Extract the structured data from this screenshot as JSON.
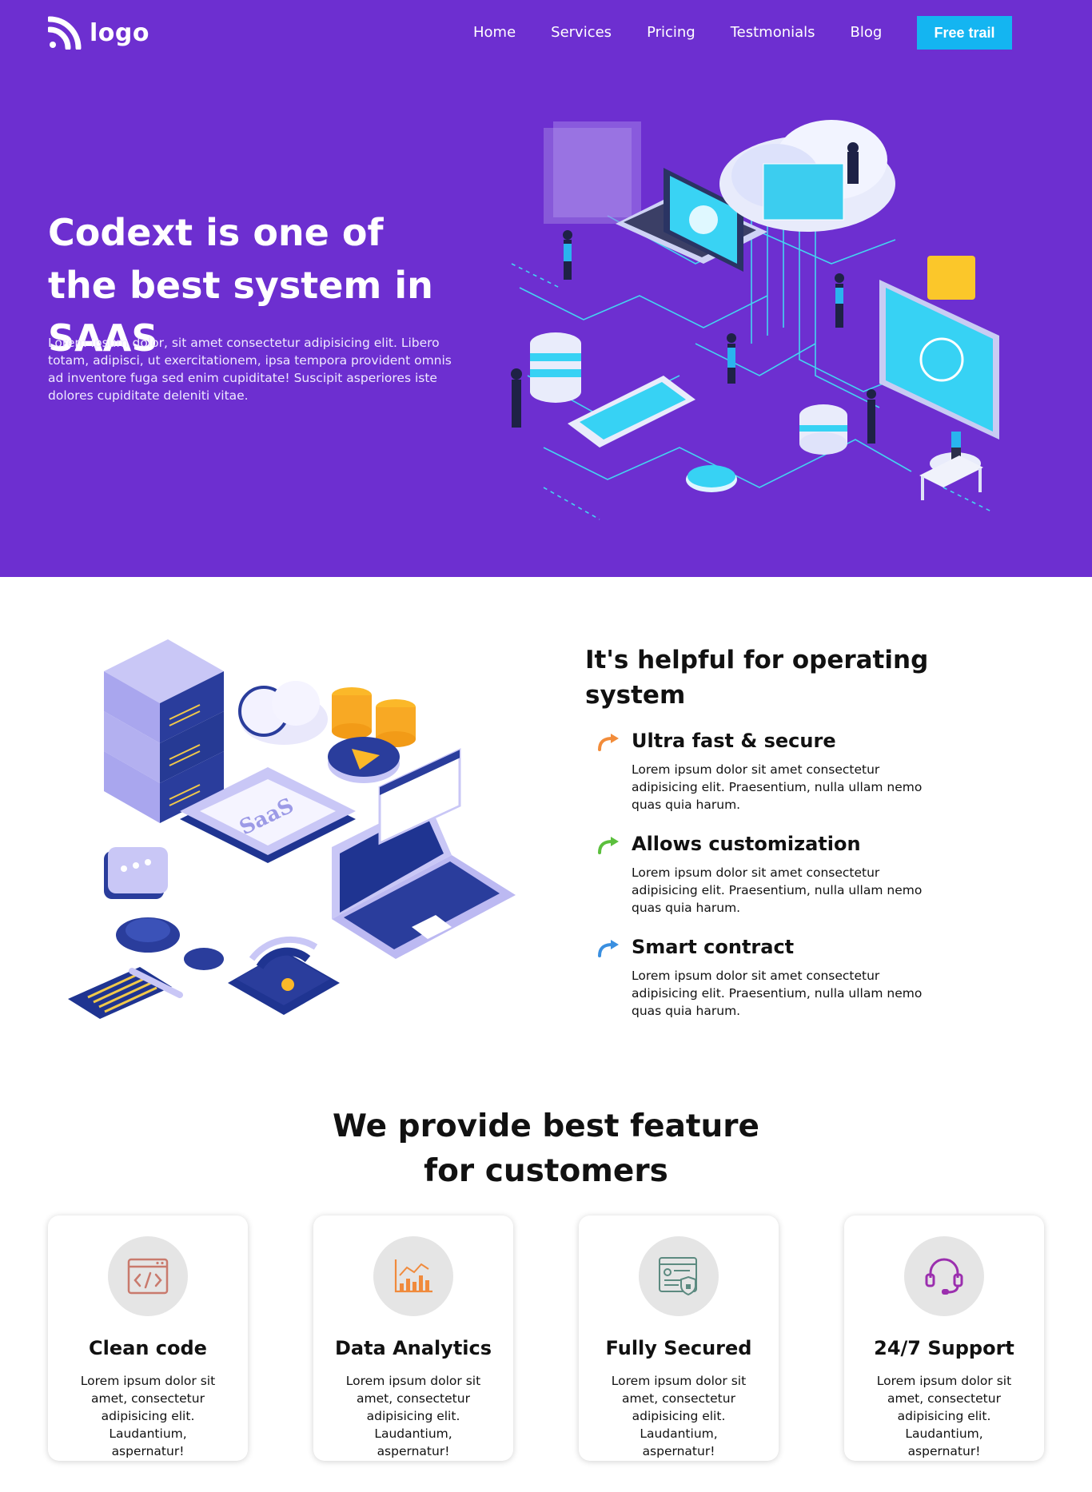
{
  "nav": {
    "logo_text": "logo",
    "items": [
      {
        "label": "Home"
      },
      {
        "label": "Services"
      },
      {
        "label": "Pricing"
      },
      {
        "label": "Testmonials"
      },
      {
        "label": "Blog"
      }
    ],
    "cta_label": "Free trail"
  },
  "hero": {
    "title": "Codext is one of the best system in SAAS",
    "description": "Lorem ipsum dolor, sit amet consectetur adipisicing elit. Libero totam, adipisci, ut exercitationem, ipsa tempora provident omnis ad inventore fuga sed enim cupiditate! Suscipit asperiores iste dolores cupiditate deleniti vitae.",
    "background_color": "#6d2fd0",
    "illustration_icon": "isometric-cloud-network-illustration"
  },
  "helpful": {
    "title": "It's helpful for operating system",
    "illustration_label": "SaaS",
    "features": [
      {
        "title": "Ultra fast & secure",
        "text": "Lorem ipsum dolor sit amet consectetur adipisicing elit. Praesentium, nulla ullam nemo quas quia harum.",
        "arrow_color": "#f28c3a"
      },
      {
        "title": "Allows customization",
        "text": "Lorem ipsum dolor sit amet consectetur adipisicing elit. Praesentium, nulla ullam nemo quas quia harum.",
        "arrow_color": "#5bbf3d"
      },
      {
        "title": "Smart contract",
        "text": "Lorem ipsum dolor sit amet consectetur adipisicing elit. Praesentium, nulla ullam nemo quas quia harum.",
        "arrow_color": "#3a8fe0"
      }
    ]
  },
  "features": {
    "title": "We provide best feature for customers",
    "cards": [
      {
        "title": "Clean code",
        "text": "Lorem ipsum dolor sit amet, consectetur adipisicing elit. Laudantium, aspernatur!",
        "icon": "code-window-icon",
        "icon_color": "#c97a6d"
      },
      {
        "title": "Data Analytics",
        "text": "Lorem ipsum dolor sit amet, consectetur adipisicing elit. Laudantium, aspernatur!",
        "icon": "bar-chart-icon",
        "icon_color": "#f08a3c"
      },
      {
        "title": "Fully Secured",
        "text": "Lorem ipsum dolor sit amet, consectetur adipisicing elit. Laudantium, aspernatur!",
        "icon": "secure-profile-icon",
        "icon_color": "#5c8a80"
      },
      {
        "title": "24/7 Support",
        "text": "Lorem ipsum dolor sit amet, consectetur adipisicing elit. Laudantium, aspernatur!",
        "icon": "headset-icon",
        "icon_color": "#9b2fae"
      }
    ]
  }
}
